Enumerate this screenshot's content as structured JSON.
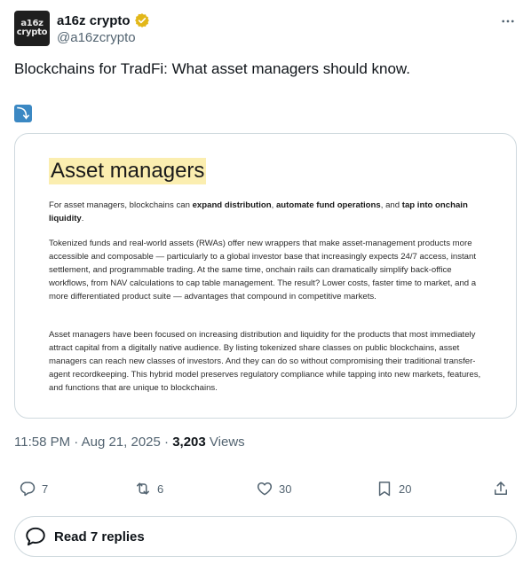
{
  "account": {
    "avatar_line1": "a16z",
    "avatar_line2": "crypto",
    "display_name": "a16z crypto",
    "handle": "@a16zcrypto"
  },
  "tweet": {
    "text": "Blockchains for TradFi: What asset managers should know.",
    "emoji_icon": "right-arrow-curving-down-icon"
  },
  "card": {
    "title": "Asset managers",
    "p1_pre": "For asset managers, blockchains can ",
    "p1_b1": "expand distribution",
    "p1_sep1": ", ",
    "p1_b2": "automate fund operations",
    "p1_sep2": ", and ",
    "p1_b3": "tap into onchain liquidity",
    "p1_post": ".",
    "p2": "Tokenized funds and real-world assets (RWAs) offer new wrappers that make asset-management products more accessible and composable — particularly to a global investor base that increasingly expects 24/7 access, instant settlement, and programmable trading. At the same time, onchain rails can dramatically simplify back-office workflows, from NAV calculations to cap table management. The result? Lower costs, faster time to market, and a more differentiated product suite — advantages that compound in competitive markets.",
    "p3": "Asset managers have been focused on increasing distribution and liquidity for the products that most immediately attract capital from a digitally native audience. By listing tokenized share classes on public blockchains, asset managers can reach new classes of investors. And they can do so without compromising their traditional transfer-agent recordkeeping. This hybrid model preserves regulatory compliance while tapping into new markets, features, and functions that are unique to blockchains."
  },
  "meta": {
    "time": "11:58 PM",
    "dot1": " · ",
    "date": "Aug 21, 2025",
    "dot2": " · ",
    "views_count": "3,203",
    "views_label": " Views"
  },
  "actions": {
    "replies": "7",
    "reposts": "6",
    "likes": "30",
    "bookmarks": "20"
  },
  "read_replies": "Read 7 replies",
  "colors": {
    "verified": "#e2b719",
    "highlight": "#fbeeb0",
    "border": "#cfd9de",
    "secondary_text": "#536471"
  }
}
